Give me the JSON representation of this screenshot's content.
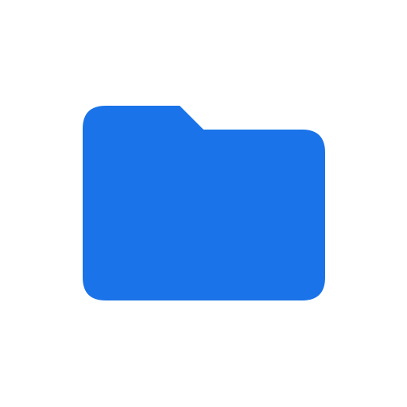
{
  "icon": {
    "name": "folder-icon",
    "color": "#1a73e8"
  }
}
